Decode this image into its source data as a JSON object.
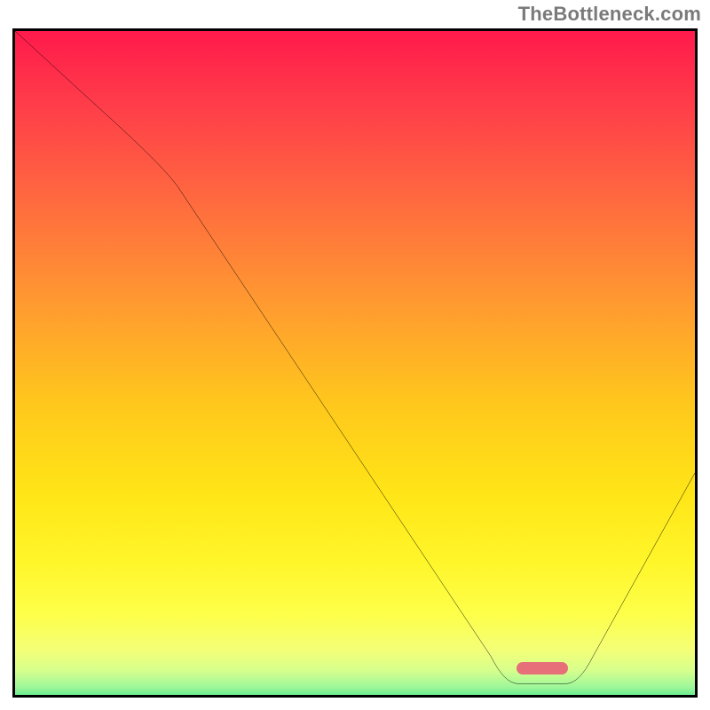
{
  "attribution": "TheBottleneck.com",
  "chart_data": {
    "type": "line",
    "title": "",
    "xlabel": "",
    "ylabel": "",
    "xlim": [
      0,
      100
    ],
    "ylim": [
      0,
      100
    ],
    "legend": false,
    "grid": false,
    "series": [
      {
        "name": "bottleneck-curve",
        "x": [
          0,
          12,
          22,
          24,
          70,
          74,
          78,
          81,
          85,
          100
        ],
        "values": [
          100,
          89,
          80,
          77,
          8,
          4,
          4,
          4,
          8,
          35
        ]
      }
    ],
    "annotations": [
      {
        "name": "optimal-marker",
        "shape": "pill",
        "x": 77.5,
        "y": 4,
        "color": "#e66f79"
      }
    ],
    "background_gradient_stops": [
      {
        "pos": 0.0,
        "color": "#ff1a4b"
      },
      {
        "pos": 0.25,
        "color": "#ff6a3f"
      },
      {
        "pos": 0.55,
        "color": "#ffc81c"
      },
      {
        "pos": 0.78,
        "color": "#fff62a"
      },
      {
        "pos": 0.94,
        "color": "#d7ff8c"
      },
      {
        "pos": 1.0,
        "color": "#0bd06f"
      }
    ]
  }
}
